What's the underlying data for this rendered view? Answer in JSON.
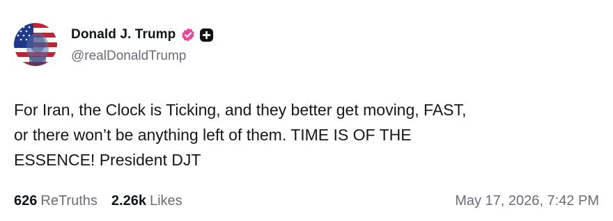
{
  "author": {
    "display_name": "Donald J. Trump",
    "handle": "@realDonaldTrump",
    "avatar_icon": "avatar-flag-portrait",
    "verified_icon": "verified-badge-icon",
    "verified_color": "#ec4899",
    "plus_icon": "plus-badge-icon"
  },
  "post": {
    "text": "For Iran, the Clock is Ticking, and they better get moving, FAST,\nor there won’t be anything left of them. TIME IS OF THE\nESSENCE! President DJT"
  },
  "stats": {
    "retruths_count": "626",
    "retruths_label": "ReTruths",
    "likes_count": "2.26k",
    "likes_label": "Likes"
  },
  "timestamp": "May 17, 2026, 7:42 PM",
  "colors": {
    "text": "#0f1419",
    "muted": "#6b6b7a",
    "badge_pink": "#ec4899"
  }
}
